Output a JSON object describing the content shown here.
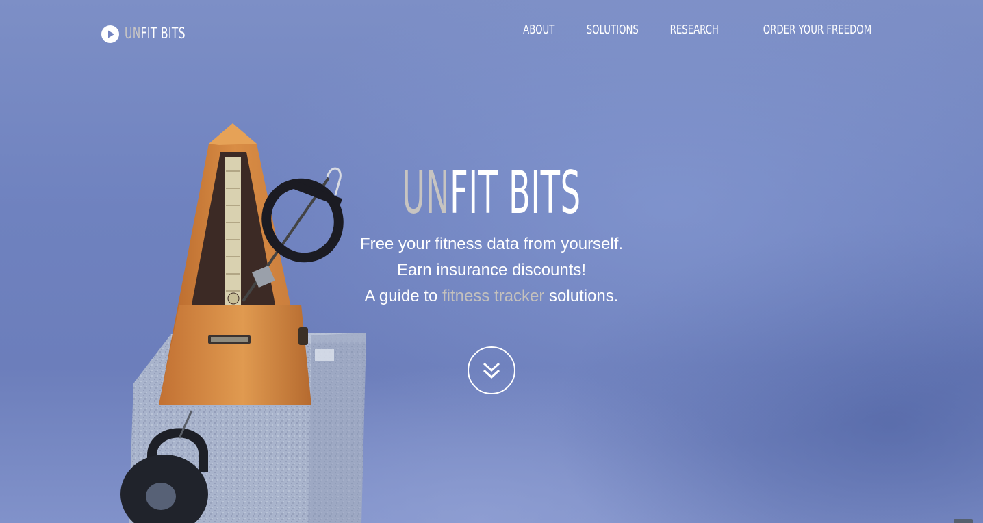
{
  "header": {
    "logo": {
      "icon": "play-circle-icon",
      "un": "UN",
      "rest": "FIT BITS"
    },
    "nav": [
      {
        "label": "ABOUT"
      },
      {
        "label": "SOLUTIONS"
      },
      {
        "label": "RESEARCH"
      },
      {
        "label": "ORDER YOUR FREEDOM"
      }
    ]
  },
  "hero": {
    "title_un": "UN",
    "title_rest": "FIT BITS",
    "line1": "Free your fitness data from yourself.",
    "line2": "Earn insurance discounts!",
    "line3_pre": "A guide to ",
    "line3_accent": "fitness tracker",
    "line3_post": " solutions.",
    "scroll_icon": "double-chevron-down-icon"
  },
  "colors": {
    "background": "#7283c0",
    "text": "#ffffff",
    "muted_accent": "#c7c4c1"
  }
}
